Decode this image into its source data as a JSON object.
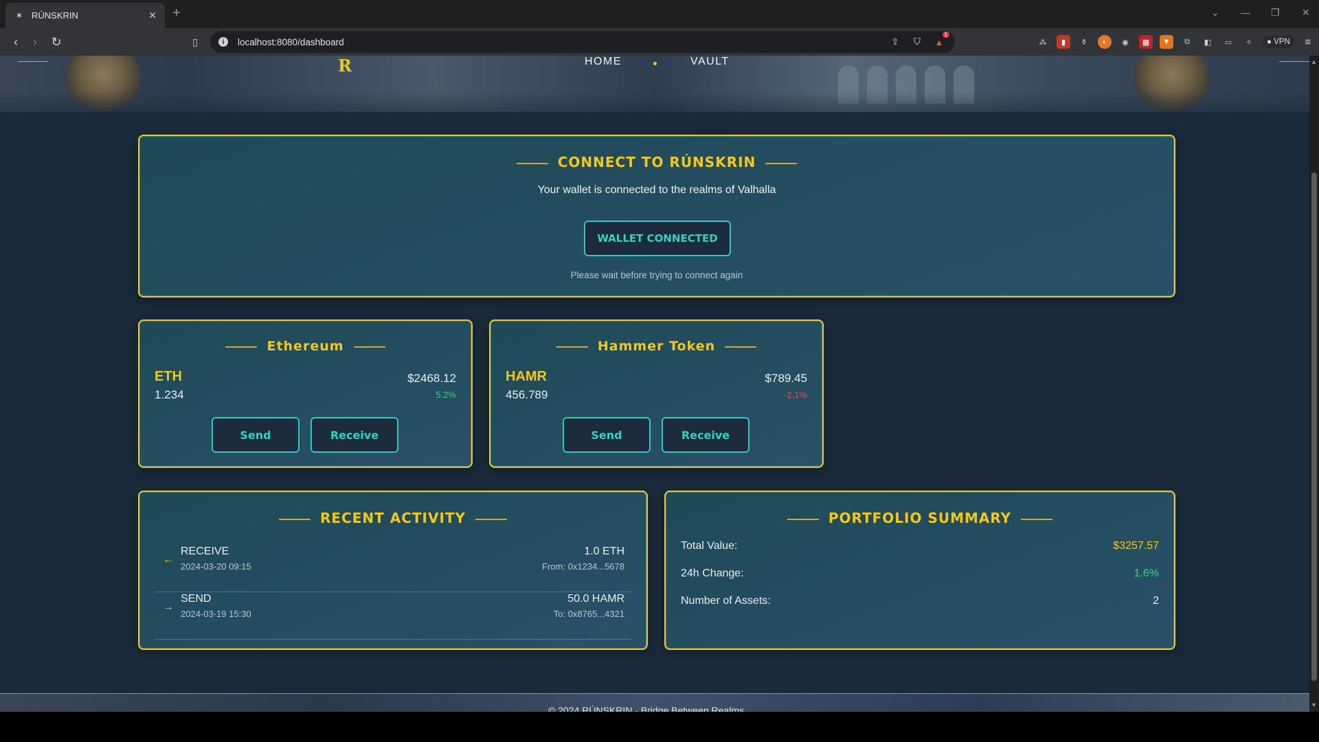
{
  "browser": {
    "tab_title": "RÚNSKRIN",
    "url": "localhost:8080/dashboard",
    "vpn_label": "VPN",
    "brave_badge": "1"
  },
  "nav": {
    "logo": "R",
    "home": "HOME",
    "vault": "VAULT"
  },
  "connect": {
    "title": "CONNECT TO RÚNSKRIN",
    "subtitle": "Your wallet is connected to the realms of Valhalla",
    "button": "WALLET CONNECTED",
    "note": "Please wait before trying to connect again"
  },
  "assets": [
    {
      "name": "Ethereum",
      "symbol": "ETH",
      "amount": "1.234",
      "price": "$2468.12",
      "change": "5.2%",
      "change_dir": "up",
      "send": "Send",
      "receive": "Receive"
    },
    {
      "name": "Hammer Token",
      "symbol": "HAMR",
      "amount": "456.789",
      "price": "$789.45",
      "change": "-2.1%",
      "change_dir": "down",
      "send": "Send",
      "receive": "Receive"
    }
  ],
  "activity": {
    "title": "RECENT ACTIVITY",
    "items": [
      {
        "arrow": "←",
        "type": "RECEIVE",
        "time": "2024-03-20 09:15",
        "amount": "1.0 ETH",
        "counterparty": "From: 0x1234...5678"
      },
      {
        "arrow": "→",
        "type": "SEND",
        "time": "2024-03-19 15:30",
        "amount": "50.0 HAMR",
        "counterparty": "To: 0x8765...4321"
      }
    ]
  },
  "portfolio": {
    "title": "PORTFOLIO SUMMARY",
    "rows": [
      {
        "label": "Total Value:",
        "value": "$3257.57"
      },
      {
        "label": "24h Change:",
        "value": "1.6%"
      },
      {
        "label": "Number of Assets:",
        "value": "2"
      }
    ]
  },
  "footer": {
    "text": "© 2024 RÚNSKRIN · Bridge Between Realms"
  },
  "colors": {
    "accent_gold": "#f2c81d",
    "accent_teal": "#2ec9bf",
    "positive": "#38d17e",
    "negative": "#e0505a",
    "page_bg": "#1a2a3a"
  }
}
